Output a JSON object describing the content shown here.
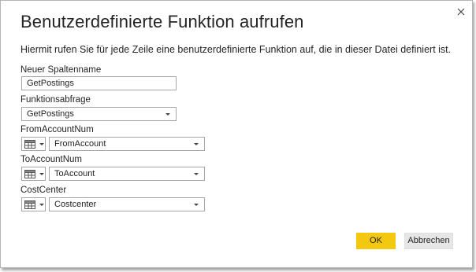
{
  "dialog": {
    "title": "Benutzerdefinierte Funktion aufrufen",
    "description": "Hiermit rufen Sie für jede Zeile eine benutzerdefinierte Funktion auf, die in dieser Datei definiert ist."
  },
  "new_column": {
    "label": "Neuer Spaltenname",
    "value": "GetPostings"
  },
  "function_query": {
    "label": "Funktionsabfrage",
    "value": "GetPostings"
  },
  "params": [
    {
      "label": "FromAccountNum",
      "type_icon": "table-column-icon",
      "value": "FromAccount"
    },
    {
      "label": "ToAccountNum",
      "type_icon": "table-column-icon",
      "value": "ToAccount"
    },
    {
      "label": "CostCenter",
      "type_icon": "table-column-icon",
      "value": "Costcenter"
    }
  ],
  "buttons": {
    "ok": "OK",
    "cancel": "Abbrechen"
  },
  "colors": {
    "accent": "#f2c811",
    "border": "#a6a6a6",
    "text": "#252423"
  }
}
